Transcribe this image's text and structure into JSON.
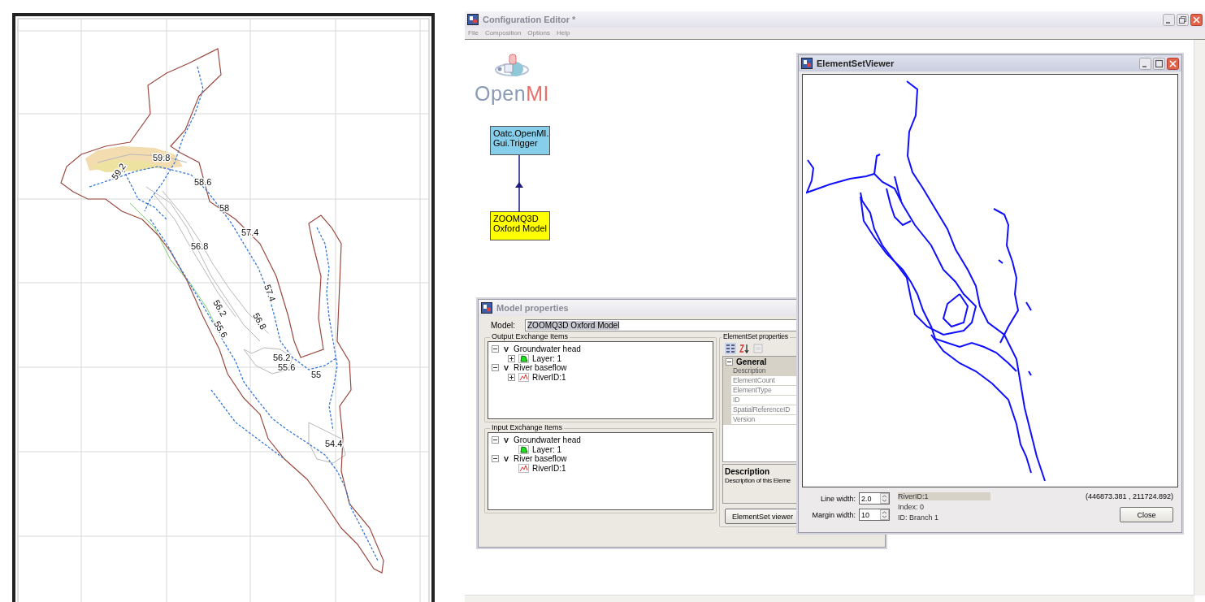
{
  "map": {
    "contour_labels": [
      "59.8",
      "59.2",
      "58.6",
      "58",
      "57.4",
      "56.8",
      "57.4",
      "56.2",
      "56.8",
      "55.6",
      "56.2",
      "55.6",
      "55",
      "54.4"
    ]
  },
  "editor": {
    "title": "Configuration Editor *",
    "menu": [
      "File",
      "Composition",
      "Options",
      "Help"
    ],
    "logo": [
      {
        "text": "Open",
        "color": "#8a9bb5"
      },
      {
        "text": "MI",
        "color": "#e8706a"
      }
    ],
    "nodes": [
      {
        "lines": [
          "Oatc.OpenMI.",
          "Gui.Trigger"
        ],
        "color": "#87ceeb"
      },
      {
        "lines": [
          "ZOOMQ3D",
          "Oxford Model"
        ],
        "color": "#ffff00"
      }
    ]
  },
  "model_properties": {
    "title": "Model properties",
    "model_label": "Model:",
    "model_value": "ZOOMQ3D Oxford Model",
    "output": {
      "title": "Output Exchange Items",
      "items": [
        {
          "badge": "V",
          "label": "Groundwater head",
          "expanded": true,
          "children": [
            {
              "kind": "polygon",
              "label": "Layer: 1",
              "expanded": false
            }
          ]
        },
        {
          "badge": "V",
          "label": "River baseflow",
          "expanded": true,
          "children": [
            {
              "kind": "polyline",
              "label": "RiverID:1",
              "expanded": false
            }
          ]
        }
      ]
    },
    "input": {
      "title": "Input Exchange Items",
      "items": [
        {
          "badge": "V",
          "label": "Groundwater head",
          "expanded": true,
          "children": [
            {
              "kind": "polygon",
              "label": "Layer: 1"
            }
          ]
        },
        {
          "badge": "V",
          "label": "River baseflow",
          "expanded": true,
          "children": [
            {
              "kind": "polyline",
              "label": "RiverID:1"
            }
          ]
        }
      ]
    },
    "element_set": {
      "title": "ElementSet properties",
      "category": {
        "label": "General",
        "expanded": true
      },
      "rows": [
        {
          "label": "Description",
          "selected": true
        },
        {
          "label": "ElementCount",
          "selected": false
        },
        {
          "label": "ElementType",
          "selected": false
        },
        {
          "label": "ID",
          "selected": false
        },
        {
          "label": "SpatialReferenceID",
          "selected": false
        },
        {
          "label": "Version",
          "selected": false
        }
      ],
      "description_title": "Description",
      "description_text": "Description of this Eleme",
      "button": "ElementSet viewer"
    }
  },
  "viewer": {
    "title": "ElementSetViewer",
    "line_width": {
      "label": "Line width:",
      "value": "2.0"
    },
    "margin_width": {
      "label": "Margin width:",
      "value": "10"
    },
    "element": "RiverID:1",
    "index": "Index: 0",
    "id": "ID: Branch 1",
    "coordinates": "(446873.381 , 211724.892)",
    "close": "Close"
  }
}
